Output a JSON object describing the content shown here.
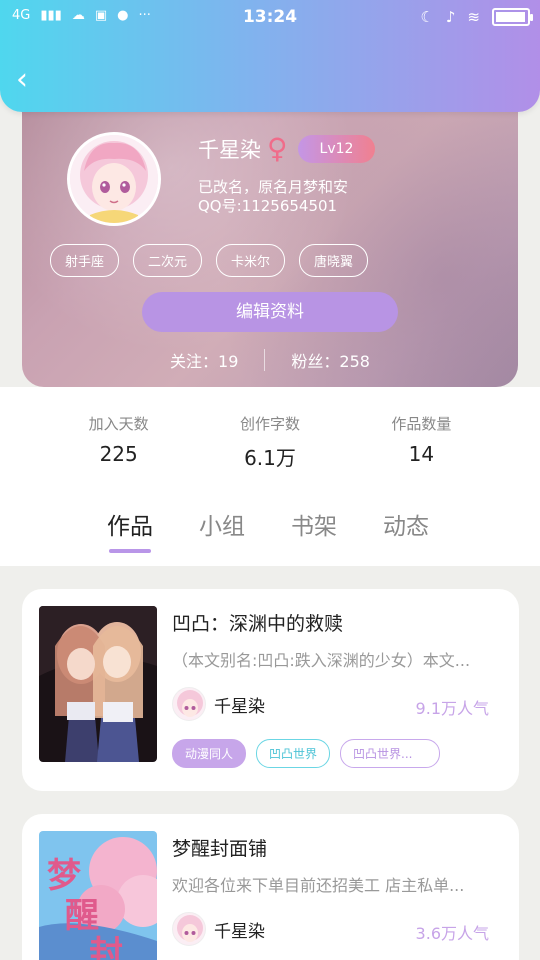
{
  "status_bar": {
    "network": "4G",
    "time": "13:24",
    "battery_level": 0.95
  },
  "profile": {
    "name": "千星染",
    "gender_symbol": "♀",
    "level": "Lv12",
    "rename_note": "已改名，原名月梦和安",
    "qq": "QQ号:1125654501",
    "tags": [
      "射手座",
      "二次元",
      "卡米尔",
      "唐晓翼"
    ],
    "edit_label": "编辑资料",
    "following_label": "关注：",
    "following_count": "19",
    "followers_label": "粉丝：",
    "followers_count": "258"
  },
  "stats": [
    {
      "label": "加入天数",
      "value": "225"
    },
    {
      "label": "创作字数",
      "value": "6.1万"
    },
    {
      "label": "作品数量",
      "value": "14"
    }
  ],
  "tabs": [
    {
      "label": "作品",
      "active": true
    },
    {
      "label": "小组",
      "active": false
    },
    {
      "label": "书架",
      "active": false
    },
    {
      "label": "动态",
      "active": false
    }
  ],
  "works": [
    {
      "title": "凹凸：深渊中的救赎",
      "description": "（本文别名:凹凸:跌入深渊的少女）本文...",
      "author": "千星染",
      "popularity": "9.1万人气",
      "tags": [
        "动漫同人",
        "凹凸世界",
        "凹凸世界..."
      ]
    },
    {
      "title": "梦醒封面铺",
      "description": "欢迎各位来下单目前还招美工 店主私单...",
      "author": "千星染",
      "popularity": "3.6万人气",
      "tags": []
    }
  ],
  "colors": {
    "header_gradient_start": "#4fd7ee",
    "header_gradient_end": "#b18fe8",
    "accent_purple": "#b996e8",
    "accent_cyan": "#4cc3d6"
  }
}
